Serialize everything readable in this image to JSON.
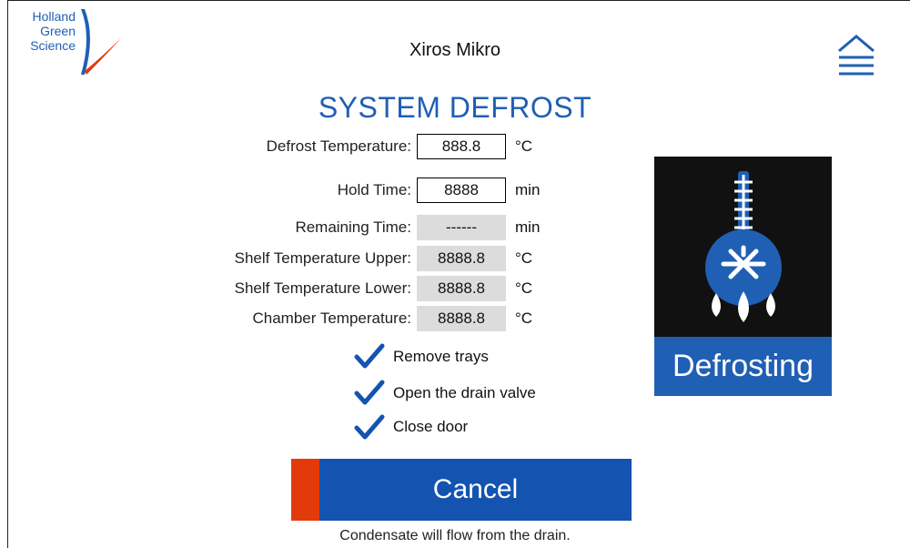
{
  "header": {
    "logo_lines": [
      "Holland",
      "Green",
      "Science"
    ],
    "app_title": "Xiros Mikro",
    "menu_icon": "hamburger-menu-icon"
  },
  "section_title": "SYSTEM DEFROST",
  "settings": {
    "defrost_temperature": {
      "label": "Defrost Temperature:",
      "value": "888.8",
      "unit": "°C"
    },
    "hold_time": {
      "label": "Hold Time:",
      "value": "8888",
      "unit": "min"
    }
  },
  "readouts": {
    "remaining_time": {
      "label": "Remaining Time:",
      "value": "------",
      "unit": "min"
    },
    "shelf_upper": {
      "label": "Shelf Temperature Upper:",
      "value": "8888.8",
      "unit": "°C"
    },
    "shelf_lower": {
      "label": "Shelf Temperature Lower:",
      "value": "8888.8",
      "unit": "°C"
    },
    "chamber": {
      "label": "Chamber Temperature:",
      "value": "8888.8",
      "unit": "°C"
    }
  },
  "checklist": [
    {
      "label": "Remove trays",
      "checked": true
    },
    {
      "label": "Open the drain valve",
      "checked": true
    },
    {
      "label": "Close door",
      "checked": true
    }
  ],
  "status": {
    "icon": "defrost-thermometer-icon",
    "label": "Defrosting"
  },
  "cancel_label": "Cancel",
  "footer_note": "Condensate will flow from the drain.",
  "colors": {
    "brand_blue": "#1f5fb4",
    "button_blue": "#1453b0",
    "accent_orange": "#e33a0b",
    "readonly_grey": "#dcdcdc"
  }
}
